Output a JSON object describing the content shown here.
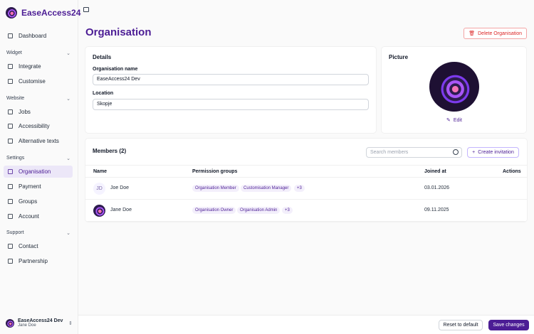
{
  "brand": {
    "name": "EaseAccess24"
  },
  "sidebar": {
    "dashboard": "Dashboard",
    "sections": [
      {
        "label": "Widget",
        "items": [
          "Integrate",
          "Customise"
        ]
      },
      {
        "label": "Website",
        "items": [
          "Jobs",
          "Accessibility",
          "Alternative texts"
        ]
      },
      {
        "label": "Settings",
        "items": [
          "Organisation",
          "Payment",
          "Groups",
          "Account"
        ]
      },
      {
        "label": "Support",
        "items": [
          "Contact",
          "Partnership"
        ]
      }
    ],
    "active": "Organisation",
    "user": {
      "org": "EaseAccess24 Dev",
      "name": "Jane Doe"
    }
  },
  "page": {
    "title": "Organisation",
    "delete_label": "Delete Organisation"
  },
  "details": {
    "title": "Details",
    "org_name_label": "Organisation name",
    "org_name_value": "EaseAccess24 Dev",
    "location_label": "Location",
    "location_value": "Skopje"
  },
  "picture": {
    "title": "Picture",
    "edit_label": "Edit"
  },
  "members": {
    "title": "Members (2)",
    "search_placeholder": "Search members",
    "invite_label": "Create invitation",
    "columns": [
      "Name",
      "Permission groups",
      "Joined at",
      "Actions"
    ],
    "rows": [
      {
        "initials": "JD",
        "name": "Joe Doe",
        "groups": [
          "Organisation Member",
          "Customisation Manager",
          "+3"
        ],
        "joined": "03.01.2026"
      },
      {
        "initials": "",
        "name": "Jane Doe",
        "groups": [
          "Organisation Owner",
          "Organisation Admin",
          "+3"
        ],
        "joined": "09.11.2025"
      }
    ]
  },
  "footer": {
    "reset_label": "Reset to default",
    "save_label": "Save changes"
  }
}
